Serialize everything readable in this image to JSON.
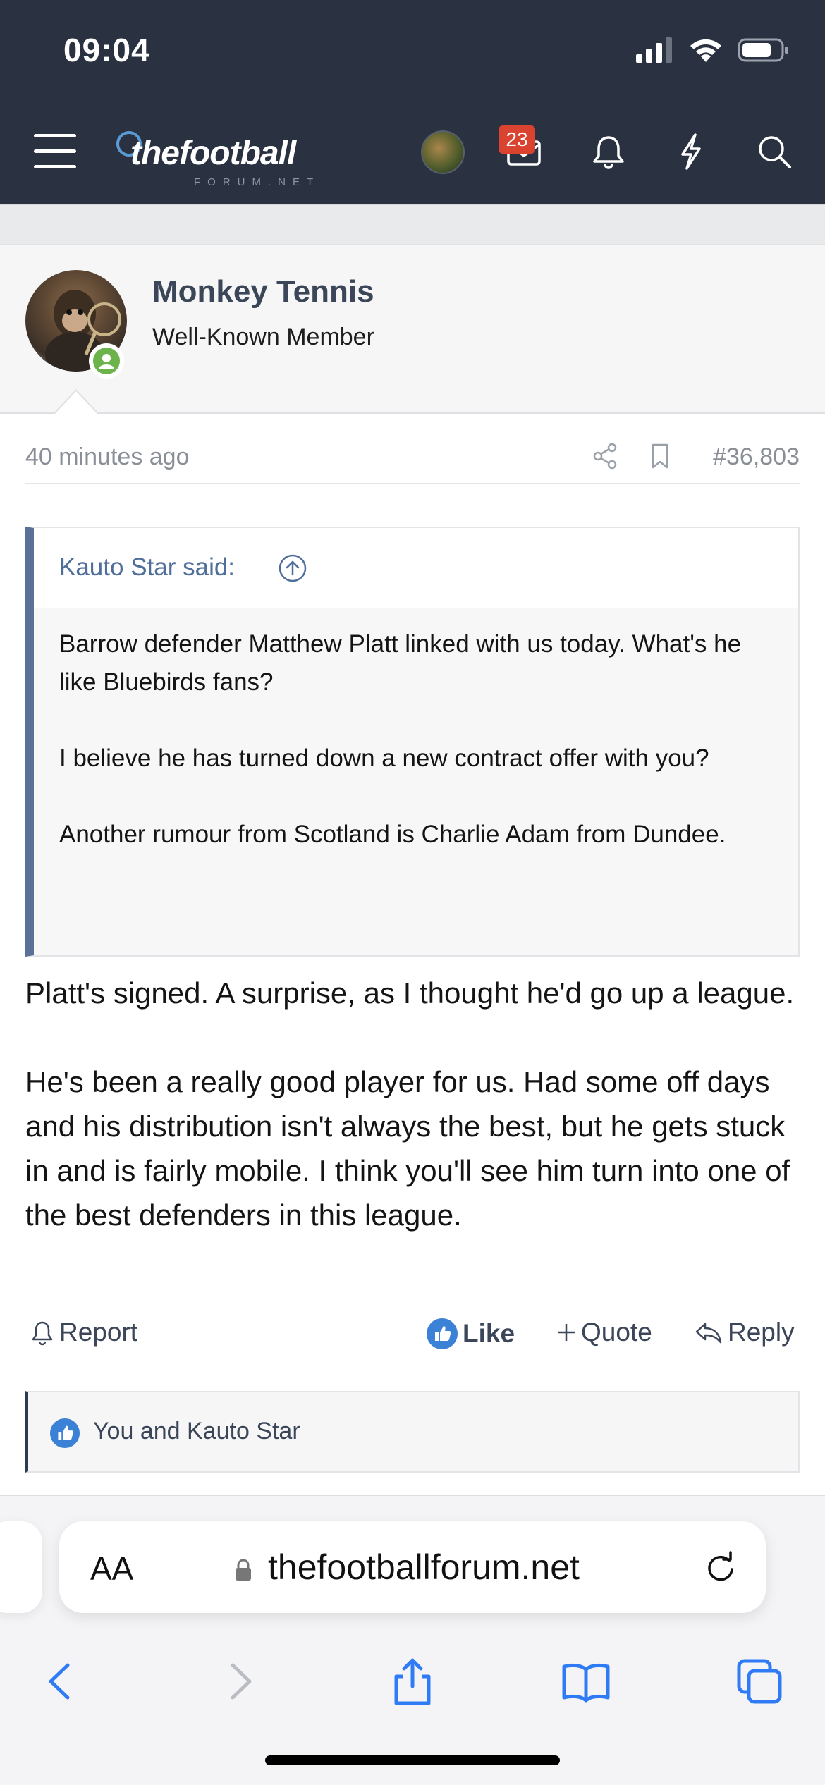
{
  "status_bar": {
    "time": "09:04"
  },
  "header": {
    "logo_text": "thefootball",
    "logo_subtext": "FORUM.NET",
    "notification_count": "23"
  },
  "post": {
    "author": "Monkey Tennis",
    "author_title": "Well-Known Member",
    "time": "40 minutes ago",
    "post_number": "#36,803",
    "quote": {
      "author": "Kauto Star said:",
      "paragraphs": [
        "Barrow defender Matthew Platt linked with us today. What's he like Bluebirds fans?",
        "I believe he has turned down a new contract offer with you?",
        "Another rumour from Scotland is Charlie Adam from Dundee."
      ]
    },
    "body": [
      "Platt's signed. A surprise, as I thought he'd go up a league.",
      "He's been a really good player for us. Had some off days and his distribution isn't always the best, but he gets stuck in and is fairly mobile. I think you'll see him turn into one of the best defenders in this league."
    ],
    "actions": {
      "report": "Report",
      "like": "Like",
      "quote": "Quote",
      "reply": "Reply"
    },
    "likes_text": "You and Kauto Star"
  },
  "browser": {
    "aa_label": "AA",
    "url": "thefootballforum.net"
  },
  "colors": {
    "header_bg": "#2a3140",
    "accent_blue": "#4f6e9a",
    "badge_red": "#d9432f",
    "online_green": "#6bb34a",
    "like_blue": "#3b82d6"
  }
}
